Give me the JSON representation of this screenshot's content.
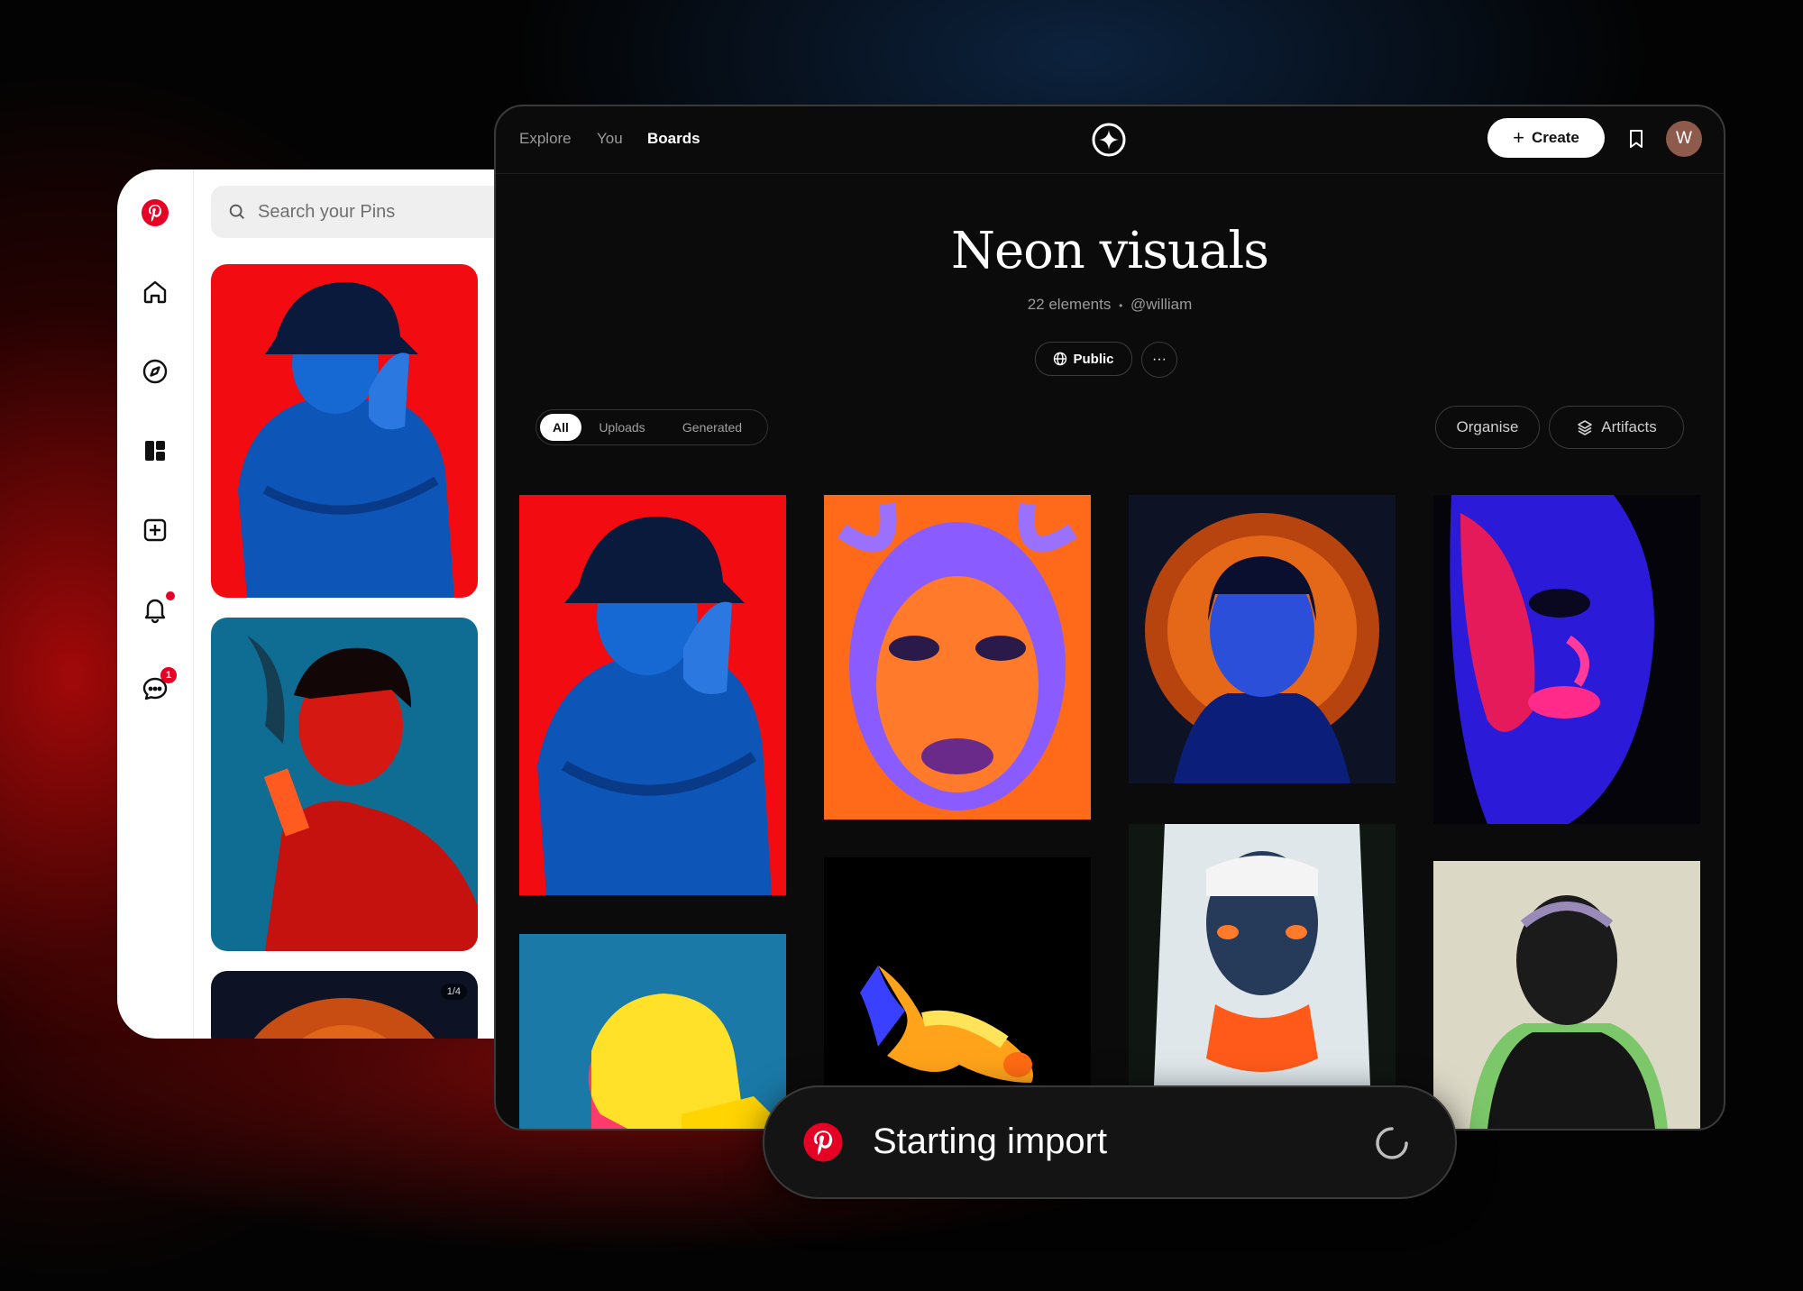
{
  "pinterest": {
    "search_placeholder": "Search your Pins",
    "rail": {
      "notifications_dot": true,
      "messages_badge": "1"
    },
    "card_counter": "1/4"
  },
  "board": {
    "nav": {
      "explore": "Explore",
      "you": "You",
      "boards": "Boards"
    },
    "create_label": "Create",
    "avatar_initial": "W",
    "title": "Neon visuals",
    "elements_count": "22 elements",
    "separator": "•",
    "owner": "@william",
    "visibility": "Public",
    "more": "···",
    "filters": [
      "All",
      "Uploads",
      "Generated"
    ],
    "active_filter": "All",
    "organise": "Organise",
    "artifacts": "Artifacts"
  },
  "toast": {
    "text": "Starting import"
  },
  "colors": {
    "pinterest_red": "#e60023",
    "board_bg": "#0b0b0b",
    "accent_white": "#ffffff"
  }
}
